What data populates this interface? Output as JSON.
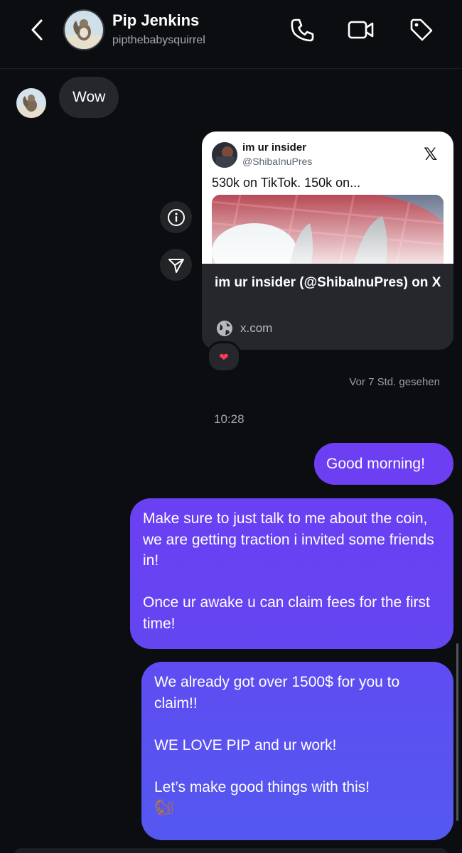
{
  "header": {
    "contact_name": "Pip Jenkins",
    "contact_handle": "pipthebabysquirrel",
    "icons": [
      "back-chevron-icon",
      "phone-icon",
      "video-camera-icon",
      "tag-icon"
    ]
  },
  "messages": {
    "incoming_text": "Wow",
    "link_card": {
      "embed_author": "im ur insider",
      "embed_handle": "@ShibaInuPres",
      "embed_text": "530k on TikTok. 150k on...",
      "title": "im ur insider (@ShibaInuPres) on X",
      "domain": "x.com",
      "platform_icon": "x-logo-icon"
    },
    "reaction": "❤",
    "side_actions": [
      "info-icon",
      "share-icon"
    ],
    "seen_status": "Vor 7 Std. gesehen",
    "timestamp": "10:28",
    "outgoing": [
      {
        "paragraphs": [
          "Good morning!"
        ]
      },
      {
        "paragraphs": [
          "Make sure to just talk to me about the coin, we are getting traction i invited some friends in!",
          "Once ur awake u can claim fees for the first time!"
        ]
      },
      {
        "paragraphs": [
          "We already got over 1500$ for you to claim!!",
          "WE LOVE PIP and ur work!",
          "Let’s make good things with this!"
        ],
        "emoji": "🐿"
      }
    ]
  },
  "colors": {
    "background": "#0c0d11",
    "incoming_bubble": "#26272c",
    "outgoing_top": "#6d3ff2",
    "outgoing_bottom": "#5458f0",
    "heart": "#ff3b4f"
  }
}
